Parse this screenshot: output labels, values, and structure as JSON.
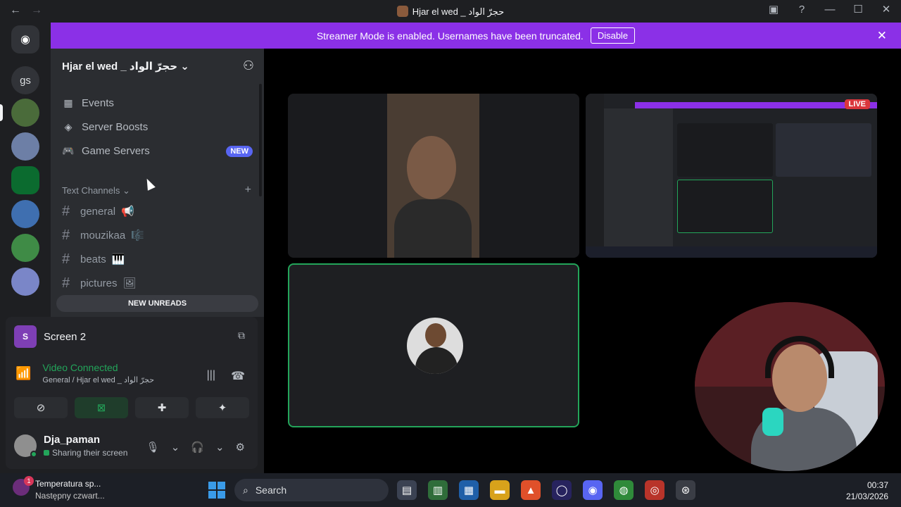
{
  "window": {
    "title": "Hjar el wed _ حجرّ الواد",
    "back_glyph": "←",
    "forward_glyph": "→",
    "inbox_glyph": "▣",
    "help_glyph": "?",
    "minimize_glyph": "—",
    "maximize_glyph": "☐",
    "close_glyph": "✕"
  },
  "banner": {
    "text": "Streamer Mode is enabled. Usernames have been truncated.",
    "button": "Disable",
    "close_glyph": "✕",
    "color": "#8b30e7"
  },
  "servers": {
    "home_glyph": "◉",
    "text_server": "gs"
  },
  "channels": {
    "server_name": "Hjar el wed _ حجرّ الواد",
    "chevron_glyph": "⌄",
    "invite_glyph": "⚇",
    "menu": [
      {
        "label": "Events",
        "icon": "calendar-icon",
        "glyph": "▦"
      },
      {
        "label": "Server Boosts",
        "icon": "boost-icon",
        "glyph": "◈"
      },
      {
        "label": "Game Servers",
        "icon": "gamepad-icon",
        "glyph": "🎮"
      }
    ],
    "new_badge": "NEW",
    "category": "Text Channels",
    "category_chevron": "⌄",
    "add_glyph": "+",
    "hash_glyph": "#",
    "text_channels": [
      {
        "name": "general",
        "emoji": "📢"
      },
      {
        "name": "mouzikaa",
        "emoji": "🎼"
      },
      {
        "name": "beats",
        "emoji": "🎹"
      },
      {
        "name": "pictures",
        "emoji": "🖼"
      }
    ],
    "new_unreads": "NEW UNREADS"
  },
  "panel": {
    "screen_icon_letter": "S",
    "screen_name": "Screen 2",
    "popout_glyph": "⧉",
    "signal_glyph": "📶",
    "voice_status": "Video Connected",
    "voice_location": "General / Hjar el wed _ حجرّ الواد",
    "noise_glyph": "|||",
    "disconnect_glyph": "☎",
    "buttons": [
      {
        "name": "camera-off",
        "glyph": "⊘"
      },
      {
        "name": "screen-share",
        "glyph": "⊠"
      },
      {
        "name": "activities",
        "glyph": "✚"
      },
      {
        "name": "soundboard",
        "glyph": "✦"
      }
    ],
    "username": "Dja_paman",
    "user_status": "Sharing their screen",
    "mic_glyph": "🎙",
    "headset_glyph": "🎧",
    "dropdown_glyph": "⌄",
    "settings_glyph": "⚙"
  },
  "stage": {
    "live_badge": "LIVE"
  },
  "taskbar": {
    "weather_badge": "1",
    "weather_line1": "Temperatura sp...",
    "weather_line2": "Następny czwart...",
    "search_label": "Search",
    "search_glyph": "⌕",
    "app_glyphs": [
      "▤",
      "▥",
      "▦",
      "▬",
      "▲",
      "◯",
      "◉",
      "◍",
      "◎",
      "⊛"
    ],
    "time": "00:37",
    "date": "21/03/2026"
  }
}
